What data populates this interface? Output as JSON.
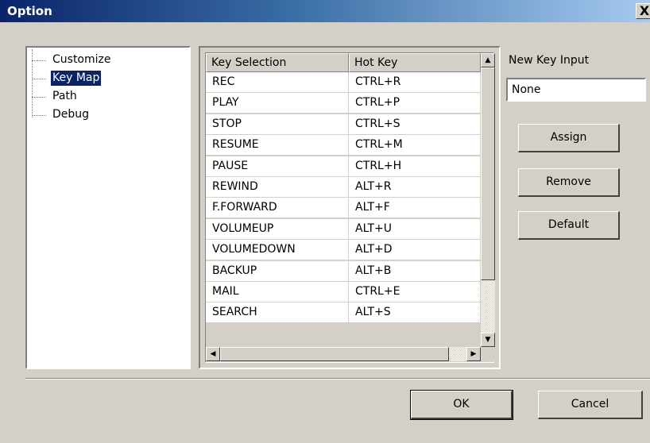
{
  "window": {
    "title": "Option",
    "close_glyph": "X"
  },
  "tree": {
    "items": [
      {
        "label": "Customize",
        "selected": false
      },
      {
        "label": "Key Map",
        "selected": true
      },
      {
        "label": "Path",
        "selected": false
      },
      {
        "label": "Debug",
        "selected": false
      }
    ]
  },
  "keymap": {
    "columns": [
      "Key Selection",
      "Hot Key"
    ],
    "rows": [
      [
        "REC",
        "CTRL+R"
      ],
      [
        "PLAY",
        "CTRL+P"
      ],
      [
        "STOP",
        "CTRL+S"
      ],
      [
        "RESUME",
        "CTRL+M"
      ],
      [
        "PAUSE",
        "CTRL+H"
      ],
      [
        "REWIND",
        "ALT+R"
      ],
      [
        "F.FORWARD",
        "ALT+F"
      ],
      [
        "VOLUMEUP",
        "ALT+U"
      ],
      [
        "VOLUMEDOWN",
        "ALT+D"
      ],
      [
        "BACKUP",
        "ALT+B"
      ],
      [
        "MAIL",
        "CTRL+E"
      ],
      [
        "SEARCH",
        "ALT+S"
      ]
    ]
  },
  "new_key": {
    "label": "New Key Input",
    "value": "None"
  },
  "buttons": {
    "assign": "Assign",
    "remove": "Remove",
    "default": "Default",
    "ok": "OK",
    "cancel": "Cancel"
  },
  "scrollbar": {
    "up": "▲",
    "down": "▼",
    "left": "◀",
    "right": "▶"
  }
}
